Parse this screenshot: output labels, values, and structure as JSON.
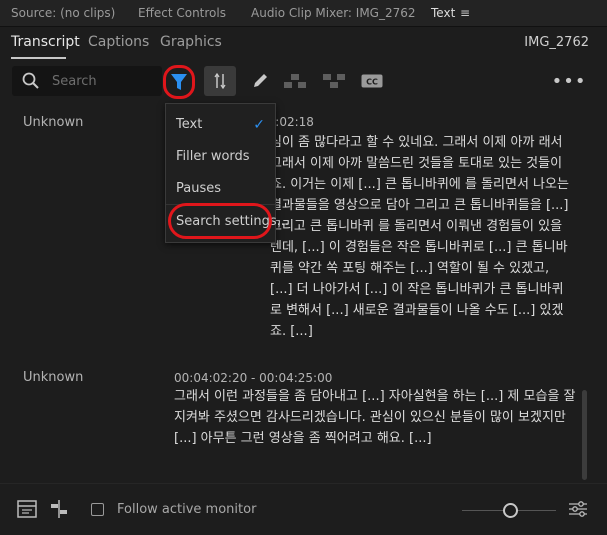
{
  "panel_tabs": [
    {
      "label": "Source: (no clips)"
    },
    {
      "label": "Effect Controls"
    },
    {
      "label": "Audio Clip Mixer: IMG_2762"
    },
    {
      "label": "Text"
    }
  ],
  "sub_tabs": [
    {
      "label": "Transcript"
    },
    {
      "label": "Captions"
    },
    {
      "label": "Graphics"
    }
  ],
  "clip_name": "IMG_2762",
  "search": {
    "placeholder": "Search"
  },
  "filter_menu": {
    "items": [
      {
        "label": "Text",
        "checked": true
      },
      {
        "label": "Filler words"
      },
      {
        "label": "Pauses"
      },
      {
        "label": "Search settings..."
      }
    ]
  },
  "transcript": {
    "blocks": [
      {
        "speaker": "Unknown",
        "timecode": "04:02:18",
        "text": "심이 좀 많다라고 할 수 있네요. 그래서 이제 아까 래서 그래서 이제 아까 말씀드린 것들을 토대로 있는 것들이죠. 이거는 이제 [...] 큰 톱니바퀴에 를 돌리면서 나오는 결과물들을 영상으로 담아 그리고 큰 톱니바퀴들을 [...] 그리고 큰 톱니바퀴 를 돌리면서 이뤄낸 경험들이 있을 텐데, [...] 이 경험들은 작은 톱니바퀴로 [...] 큰 톱니바퀴를 약간 쏙 포팅 해주는 [...] 역할이 될 수 있겠고, [...] 더 나아가서 [...] 이 작은 톱니바퀴가 큰 톱니바퀴로 변해서 [...] 새로운 결과물들이 나올 수도 [...] 있겠죠. [...]"
      },
      {
        "speaker": "Unknown",
        "timecode": "00:04:02:20 - 00:04:25:00",
        "text": "그래서 이런 과정들을 좀 담아내고 [...] 자아실현을 하는 [...] 제 모습을 잘 지켜봐 주셨으면 감사드리겠습니다. 관심이 있으신 분들이 많이 보겠지만 [...] 아무튼 그런 영상을 좀 찍어려고 해요. [...]"
      }
    ]
  },
  "footer": {
    "follow_label": "Follow active monitor"
  },
  "colors": {
    "accent_blue": "#2b8ff0",
    "highlight_red": "#e0161b"
  }
}
